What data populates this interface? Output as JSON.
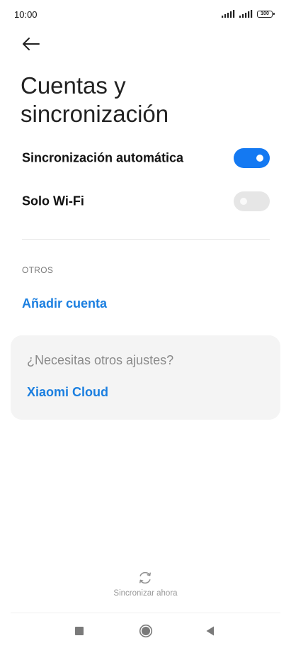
{
  "status_bar": {
    "time": "10:00",
    "battery": "100"
  },
  "header": {
    "title": "Cuentas y sincronización"
  },
  "settings": {
    "auto_sync": {
      "label": "Sincronización automática",
      "enabled": true
    },
    "wifi_only": {
      "label": "Solo Wi-Fi",
      "enabled": false
    }
  },
  "others": {
    "section_label": "OTROS",
    "add_account": "Añadir cuenta"
  },
  "card": {
    "title": "¿Necesitas otros ajustes?",
    "link": "Xiaomi Cloud"
  },
  "footer": {
    "sync_now": "Sincronizar ahora"
  },
  "colors": {
    "accent": "#1479f2",
    "link": "#1b7fe0"
  },
  "icons": {
    "back": "arrow-left-icon",
    "sync": "sync-icon",
    "nav_recents": "square-icon",
    "nav_home": "circle-icon",
    "nav_back": "triangle-left-icon"
  }
}
